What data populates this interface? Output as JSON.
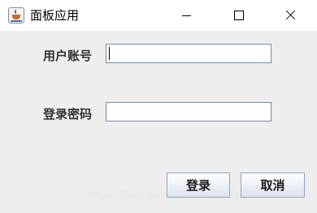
{
  "window": {
    "title": "面板应用",
    "app_icon": "java-cup-icon",
    "controls": [
      "minimize-icon",
      "maximize-icon",
      "close-icon"
    ]
  },
  "form": {
    "account_label": "用户账号",
    "account_value": "",
    "password_label": "登录密码",
    "password_value": ""
  },
  "buttons": {
    "login_label": "登录",
    "cancel_label": "取消"
  },
  "watermark": "https://blog.csdn.net/weixin_45662817"
}
